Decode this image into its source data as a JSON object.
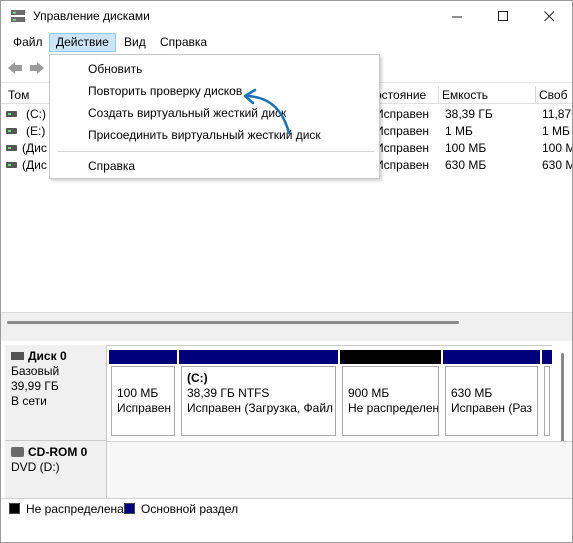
{
  "window": {
    "title": "Управление дисками",
    "icon": "disk-management-icon"
  },
  "menubar": {
    "file": "Файл",
    "action": "Действие",
    "view": "Вид",
    "help": "Справка"
  },
  "action_menu": {
    "items": [
      "Обновить",
      "Повторить проверку дисков",
      "Создать виртуальный жесткий диск",
      "Присоединить виртуальный жесткий диск"
    ],
    "help": "Справка",
    "highlighted_index": 1,
    "annotation_arrow_color": "#1f6fb5"
  },
  "volume_list": {
    "headers": [
      "Том",
      "остояние",
      "Емкость",
      "Своб"
    ],
    "rows": [
      {
        "volume": "(C:)",
        "status": "Исправен",
        "capacity": "38,39 ГБ",
        "free": "11,87"
      },
      {
        "volume": "(E:)",
        "status": "Исправен",
        "capacity": "1 МБ",
        "free": "1 МБ"
      },
      {
        "volume": "(Дис",
        "status": "Исправен",
        "capacity": "100 МБ",
        "free": "100 М"
      },
      {
        "volume": "(Дис",
        "status": "Исправен",
        "capacity": "630 МБ",
        "free": "630 М"
      }
    ]
  },
  "disks": {
    "disk0": {
      "name": "Диск 0",
      "type": "Базовый",
      "size": "39,99 ГБ",
      "status": "В сети",
      "partitions": [
        {
          "label": "",
          "size": "100 МБ",
          "status": "Исправен",
          "kind": "primary"
        },
        {
          "label": "(C:)",
          "size": "38,39 ГБ NTFS",
          "status": "Исправен (Загрузка, Файл",
          "kind": "primary"
        },
        {
          "label": "",
          "size": "900 МБ",
          "status": "Не распределен",
          "kind": "unallocated"
        },
        {
          "label": "",
          "size": "630 МБ",
          "status": "Исправен (Раз",
          "kind": "primary"
        },
        {
          "label": "",
          "size": "",
          "status": "",
          "kind": "primary"
        }
      ]
    },
    "cdrom": {
      "name": "CD-ROM 0",
      "drive": "DVD (D:)"
    }
  },
  "legend": {
    "unallocated": "Не распределена",
    "primary": "Основной раздел"
  },
  "colors": {
    "primary": "#00007b",
    "unallocated": "#000000",
    "menu_highlight": "#cce4f7"
  }
}
